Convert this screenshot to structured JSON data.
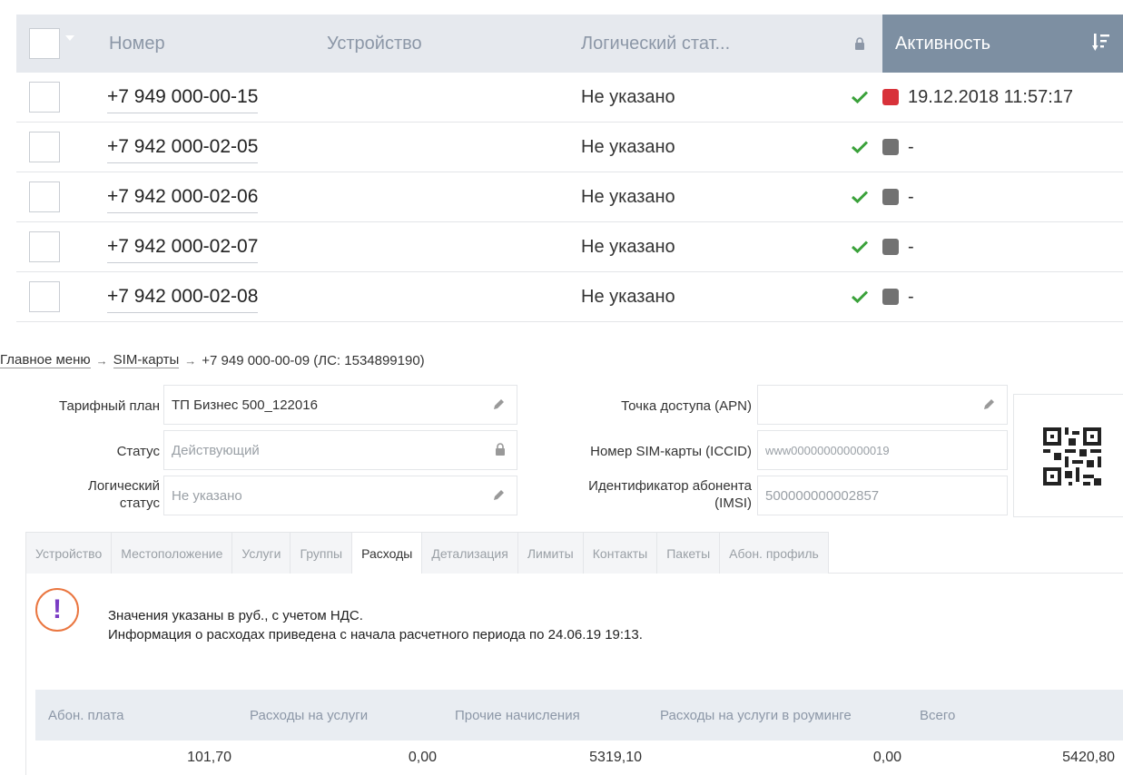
{
  "sim_table": {
    "headers": {
      "number": "Номер",
      "device": "Устройство",
      "logical_status": "Логический стат...",
      "activity": "Активность"
    },
    "rows": [
      {
        "number": "+7 949 000-00-15",
        "device": "",
        "status": "Не указано",
        "activity": "19.12.2018 11:57:17",
        "activity_color": "#d8323a"
      },
      {
        "number": "+7 942 000-02-05",
        "device": "",
        "status": "Не указано",
        "activity": "-",
        "activity_color": "#727272"
      },
      {
        "number": "+7 942 000-02-06",
        "device": "",
        "status": "Не указано",
        "activity": "-",
        "activity_color": "#727272"
      },
      {
        "number": "+7 942 000-02-07",
        "device": "",
        "status": "Не указано",
        "activity": "-",
        "activity_color": "#727272"
      },
      {
        "number": "+7 942 000-02-08",
        "device": "",
        "status": "Не указано",
        "activity": "-",
        "activity_color": "#727272"
      }
    ]
  },
  "breadcrumb": {
    "main": "Главное меню",
    "sim": "SIM-карты",
    "current": "+7 949 000-00-09 (ЛС: 1534899190)",
    "sep": "→"
  },
  "form": {
    "tariff_label": "Тарифный план",
    "tariff_value": "ТП Бизнес 500_122016",
    "status_label": "Статус",
    "status_value": "Действующий",
    "logical_label_1": "Логический",
    "logical_label_2": "статус",
    "logical_value": "Не указано",
    "apn_label": "Точка доступа (APN)",
    "apn_value": "",
    "iccid_label": "Номер SIM-карты (ICCID)",
    "iccid_value": "www000000000000019",
    "imsi_label_1": "Идентификатор абонента",
    "imsi_label_2": "(IMSI)",
    "imsi_value": "500000000002857"
  },
  "tabs": [
    {
      "label": "Устройство",
      "active": false
    },
    {
      "label": "Местоположение",
      "active": false
    },
    {
      "label": "Услуги",
      "active": false
    },
    {
      "label": "Группы",
      "active": false
    },
    {
      "label": "Расходы",
      "active": true
    },
    {
      "label": "Детализация",
      "active": false
    },
    {
      "label": "Лимиты",
      "active": false
    },
    {
      "label": "Контакты",
      "active": false
    },
    {
      "label": "Пакеты",
      "active": false
    },
    {
      "label": "Абон. профиль",
      "active": false
    }
  ],
  "info": {
    "line1": "Значения указаны в руб., с учетом НДС.",
    "line2": "Информация о расходах приведена с начала расчетного периода по 24.06.19 19:13.",
    "icon": "!"
  },
  "expenses": {
    "headers": [
      "Абон. плата",
      "Расходы на услуги",
      "Прочие начисления",
      "Расходы на услуги в роуминге",
      "Всего"
    ],
    "values": [
      "101,70",
      "0,00",
      "5319,10",
      "0,00",
      "5420,80"
    ]
  },
  "colors": {
    "header_bg": "#e6e9ee",
    "activity_header_bg": "#7d8fa2",
    "check_green": "#3aa13a",
    "warn_orange": "#ea7640",
    "warn_purple": "#7a3cc4"
  }
}
